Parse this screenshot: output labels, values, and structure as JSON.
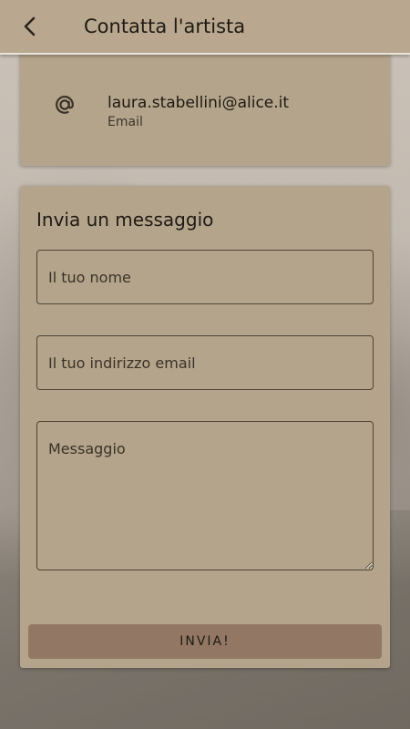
{
  "header": {
    "title": "Contatta l'artista",
    "back_icon": "chevron-left-icon"
  },
  "contact": {
    "icon": "at-icon",
    "value": "laura.stabellini@alice.it",
    "label": "Email"
  },
  "form": {
    "title": "Invia un messaggio",
    "name_placeholder": "Il tuo nome",
    "email_placeholder": "Il tuo indirizzo email",
    "message_placeholder": "Messaggio",
    "submit_label": "INVIA!"
  },
  "colors": {
    "header_bg": "#b9a88f",
    "card_bg": "#b4a48b",
    "button_bg": "#927864",
    "text": "#1f1a14"
  }
}
